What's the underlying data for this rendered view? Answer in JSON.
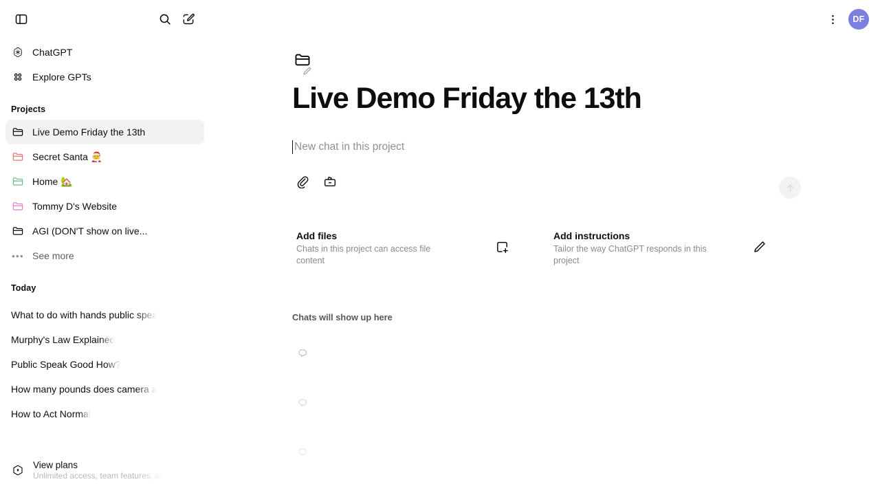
{
  "sidebar": {
    "top_icons": [
      {
        "name": "toggle-sidebar-icon",
        "label": "Toggle sidebar"
      },
      {
        "name": "search-icon",
        "label": "Search chats"
      },
      {
        "name": "new-chat-icon",
        "label": "New chat"
      }
    ],
    "nav": [
      {
        "label": "ChatGPT",
        "icon": "openai-logo-icon"
      },
      {
        "label": "Explore GPTs",
        "icon": "grid-icon"
      }
    ],
    "projects_label": "Projects",
    "projects": [
      {
        "label": "Live Demo Friday the 13th",
        "color": "#0d0d0d",
        "active": true
      },
      {
        "label": "Secret Santa 🧑‍🎄",
        "color": "#e8776f",
        "active": false
      },
      {
        "label": "Home 🏡",
        "color": "#6cbf84",
        "active": false
      },
      {
        "label": "Tommy D's Website",
        "color": "#e07fc8",
        "active": false
      },
      {
        "label": "AGI (DON'T show on live...",
        "color": "#0d0d0d",
        "active": false
      }
    ],
    "see_more_label": "See more",
    "today_label": "Today",
    "chats": [
      {
        "title": "What to do with hands public speaking"
      },
      {
        "title": "Murphy's Law Explained"
      },
      {
        "title": "Public Speak Good How?"
      },
      {
        "title": "How many pounds does camera add"
      },
      {
        "title": "How to Act Normal"
      }
    ],
    "footer": {
      "plan_title": "View plans",
      "plan_subtitle": "Unlimited access, team features, and more",
      "plan_icon": "upgrade-hexagon-icon"
    }
  },
  "topbar": {
    "menu_icon": "more-options-icon",
    "avatar_initials": "DF",
    "avatar_color": "#7b7fe0"
  },
  "main": {
    "project_icon": "project-folder-icon",
    "edit_icon": "pencil-icon",
    "title": "Live Demo Friday the 13th",
    "composer": {
      "placeholder": "New chat in this project",
      "attach_icon": "paperclip-icon",
      "tools_icon": "toolbox-icon",
      "send_icon": "arrow-up-icon"
    },
    "cards": [
      {
        "title": "Add files",
        "subtitle": "Chats in this project can access file content",
        "icon": "file-plus-icon"
      },
      {
        "title": "Add instructions",
        "subtitle": "Tailor the way ChatGPT responds in this project",
        "icon": "pencil-icon"
      }
    ],
    "chats_empty_label": "Chats will show up here",
    "ghost_icon": "chat-bubble-icon"
  }
}
